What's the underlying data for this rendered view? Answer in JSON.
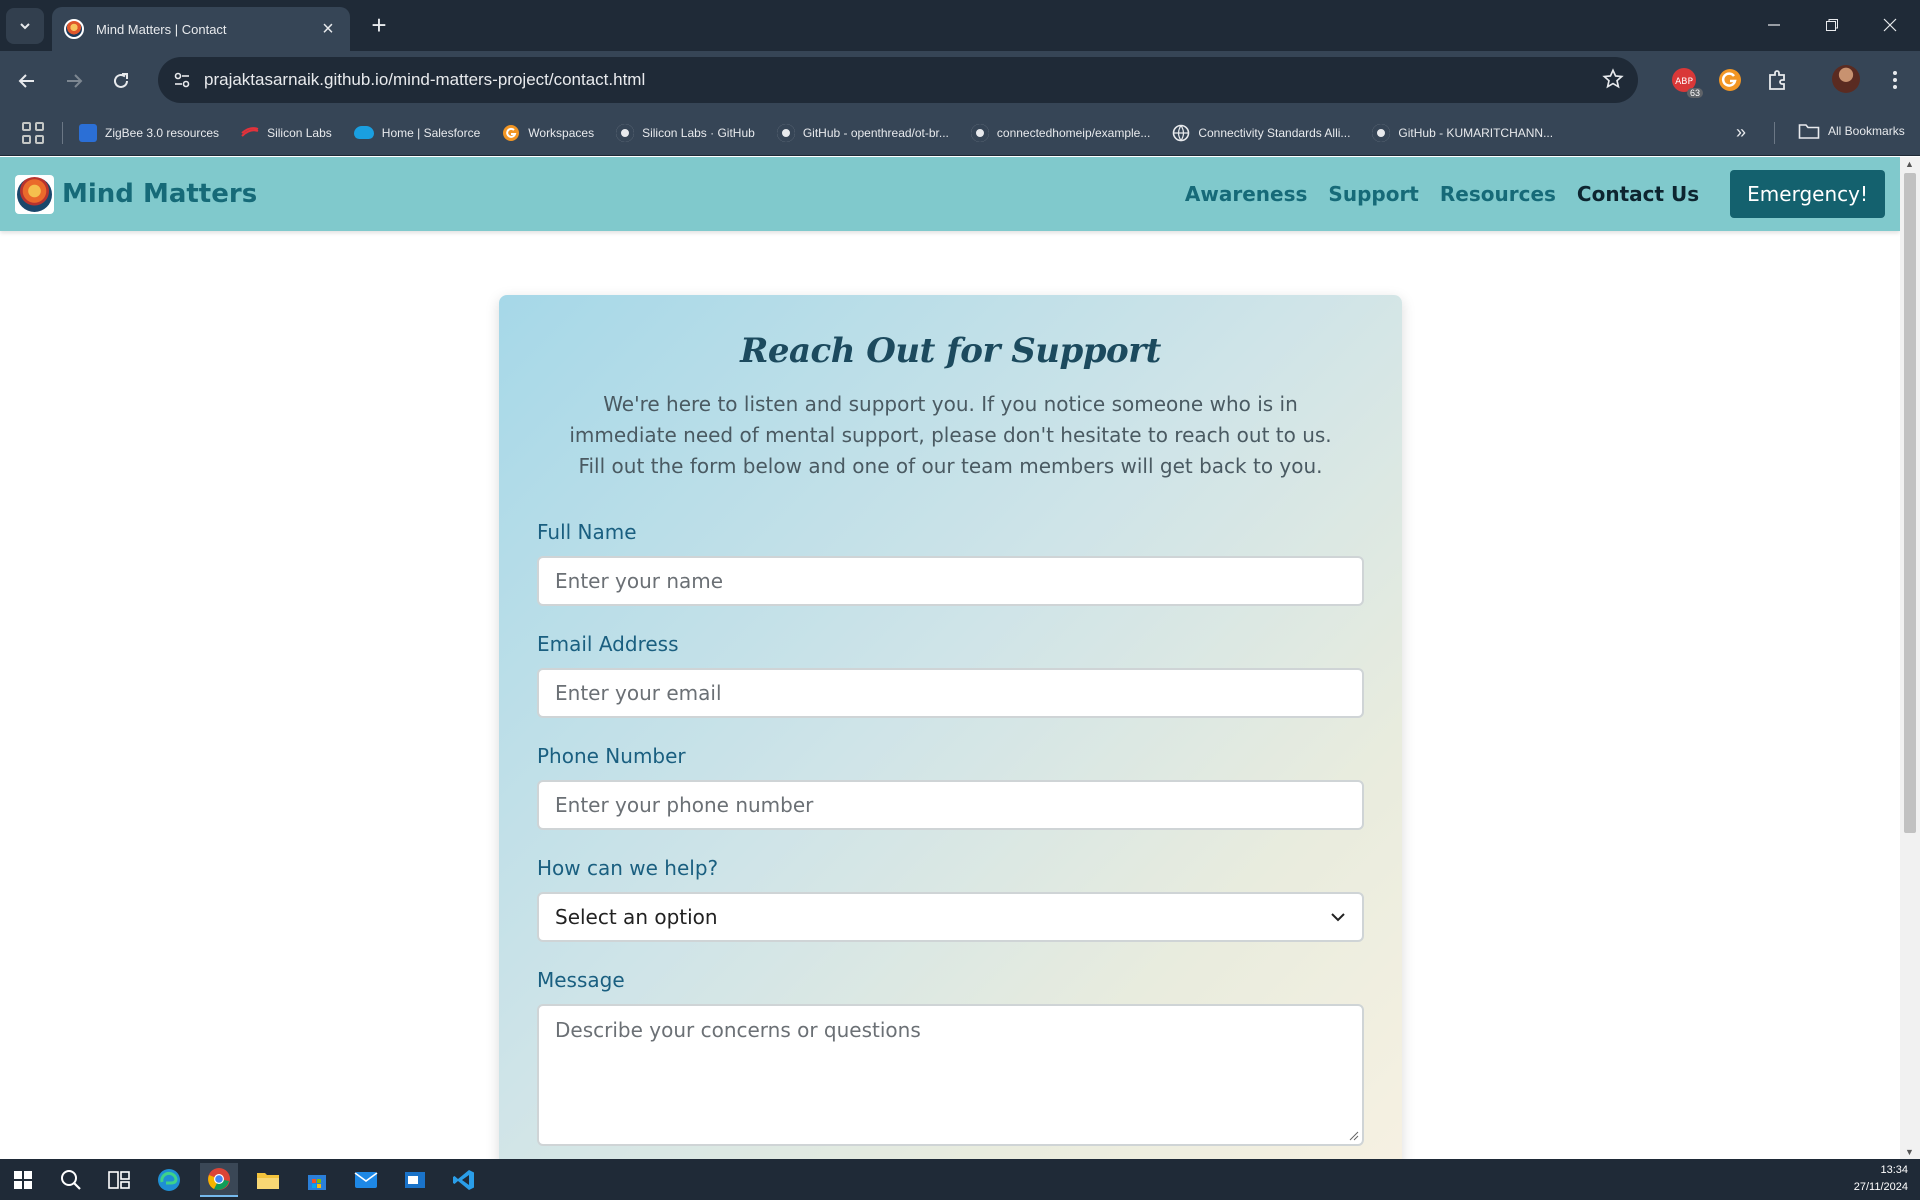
{
  "browser": {
    "tab_title": "Mind Matters | Contact",
    "url": "prajaktasarnaik.github.io/mind-matters-project/contact.html",
    "extension_badge": "63",
    "bookmarks": [
      {
        "label": "ZigBee 3.0 resources",
        "icon": "zigbee-icon"
      },
      {
        "label": "Silicon Labs",
        "icon": "silicon-labs-icon"
      },
      {
        "label": "Home | Salesforce",
        "icon": "salesforce-icon"
      },
      {
        "label": "Workspaces",
        "icon": "workspaces-icon"
      },
      {
        "label": "Silicon Labs · GitHub",
        "icon": "github-icon"
      },
      {
        "label": "GitHub - openthread/ot-br...",
        "icon": "github-icon"
      },
      {
        "label": "connectedhomeip/example...",
        "icon": "github-icon"
      },
      {
        "label": "Connectivity Standards Alli...",
        "icon": "globe-icon"
      },
      {
        "label": "GitHub - KUMARITCHANN...",
        "icon": "github-icon"
      }
    ],
    "all_bookmarks": "All Bookmarks"
  },
  "site": {
    "brand": "Mind Matters",
    "nav": [
      "Awareness",
      "Support",
      "Resources",
      "Contact Us"
    ],
    "emergency": "Emergency!"
  },
  "form": {
    "title": "Reach Out for Support",
    "intro": "We're here to listen and support you. If you notice someone who is in immediate need of mental support, please don't hesitate to reach out to us. Fill out the form below and one of our team members will get back to you.",
    "name_label": "Full Name",
    "name_placeholder": "Enter your name",
    "email_label": "Email Address",
    "email_placeholder": "Enter your email",
    "phone_label": "Phone Number",
    "phone_placeholder": "Enter your phone number",
    "help_label": "How can we help?",
    "help_selected": "Select an option",
    "message_label": "Message",
    "message_placeholder": "Describe your concerns or questions"
  },
  "taskbar": {
    "time": "13:34",
    "date": "27/11/2024"
  },
  "colors": {
    "header_bg": "#80c9cc",
    "brand": "#166a78",
    "emergency_bg": "#14616e",
    "label": "#1a5f80"
  }
}
